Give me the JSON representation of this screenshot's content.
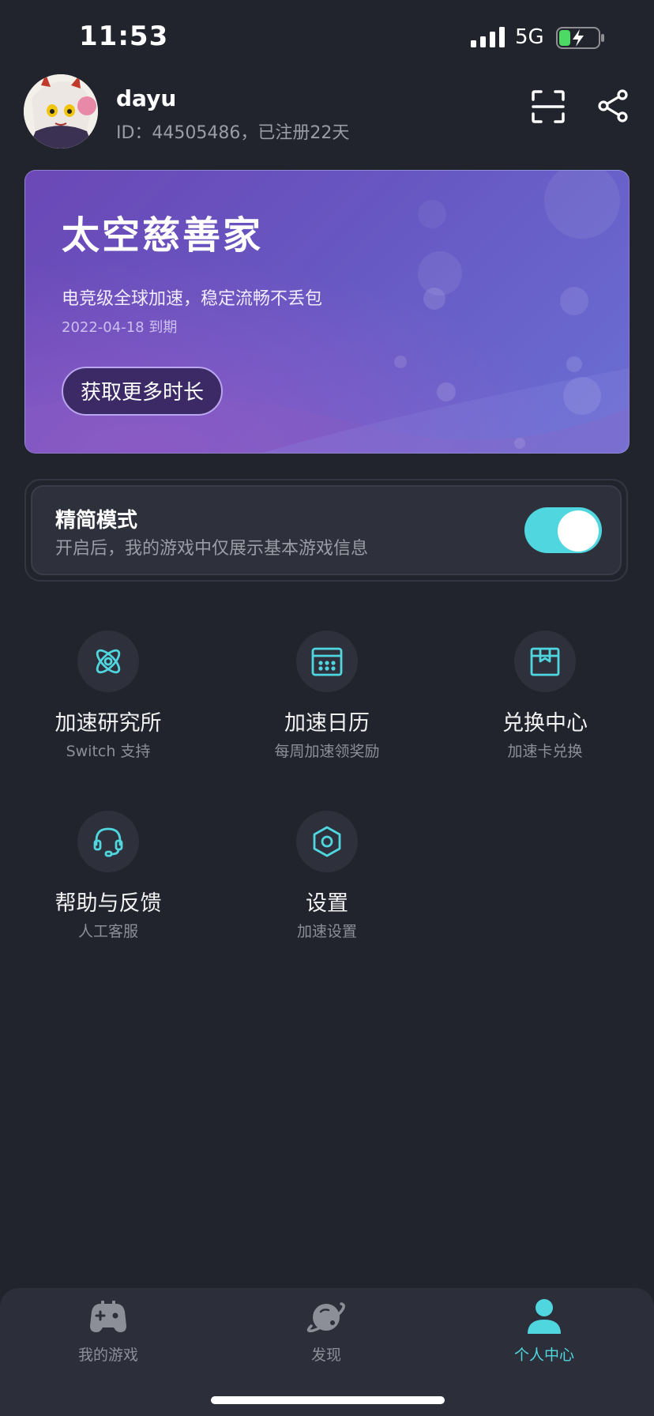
{
  "status_bar": {
    "time": "11:53",
    "network": "5G"
  },
  "profile": {
    "username": "dayu",
    "meta": "ID：44505486，已注册22天"
  },
  "membership": {
    "title": "太空慈善家",
    "subtitle": "电竞级全球加速，稳定流畅不丢包",
    "expire": "2022-04-18 到期",
    "button_label": "获取更多时长"
  },
  "simple_mode": {
    "title": "精简模式",
    "description": "开启后，我的游戏中仅展示基本游戏信息",
    "enabled": true
  },
  "features": [
    {
      "title": "加速研究所",
      "subtitle": "Switch 支持",
      "icon": "atom-icon"
    },
    {
      "title": "加速日历",
      "subtitle": "每周加速领奖励",
      "icon": "calendar-icon"
    },
    {
      "title": "兑换中心",
      "subtitle": "加速卡兑换",
      "icon": "gift-box-icon"
    },
    {
      "title": "帮助与反馈",
      "subtitle": "人工客服",
      "icon": "headset-icon"
    },
    {
      "title": "设置",
      "subtitle": "加速设置",
      "icon": "settings-hex-icon"
    }
  ],
  "bottom_nav": [
    {
      "label": "我的游戏",
      "icon": "gamepad-icon",
      "active": false
    },
    {
      "label": "发现",
      "icon": "planet-icon",
      "active": false
    },
    {
      "label": "个人中心",
      "icon": "user-icon",
      "active": true
    }
  ],
  "colors": {
    "background": "#22242d",
    "accent": "#4fd6df",
    "card_gradient_start": "#6b48b6",
    "card_gradient_end": "#6a6fd4",
    "nav_inactive": "#8c8e98"
  }
}
